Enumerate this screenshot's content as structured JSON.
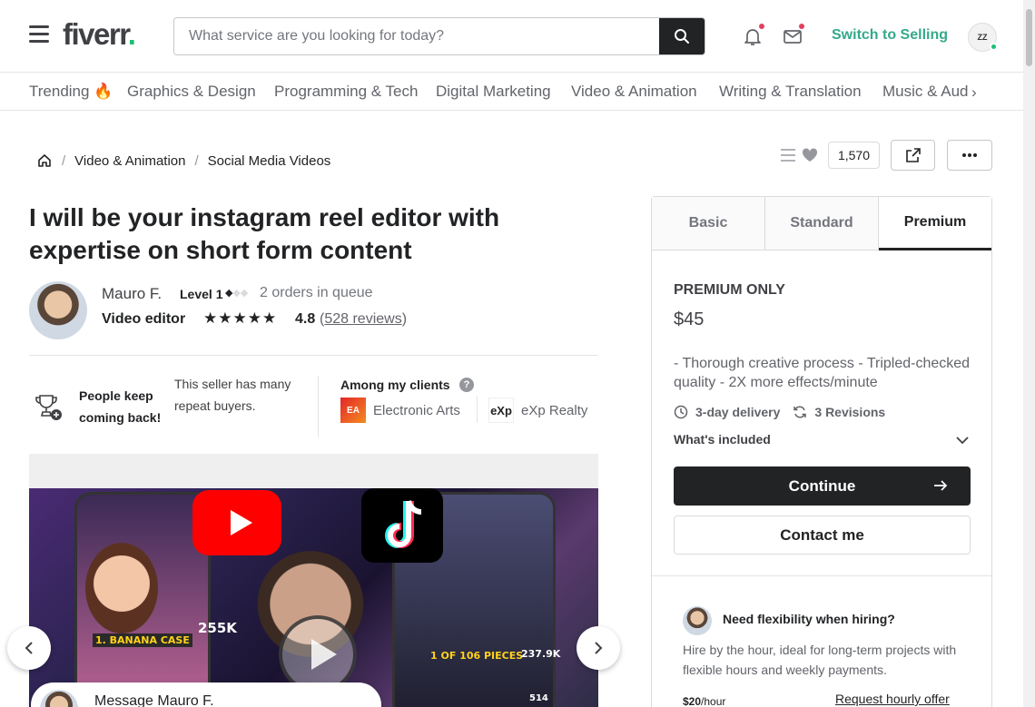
{
  "header": {
    "logo_text": "fiverr",
    "logo_dot": ".",
    "search_placeholder": "What service are you looking for today?",
    "switch_selling": "Switch to Selling",
    "avatar_text": "ZZ"
  },
  "categories": [
    {
      "label": "Trending 🔥"
    },
    {
      "label": "Graphics & Design"
    },
    {
      "label": "Programming & Tech"
    },
    {
      "label": "Digital Marketing"
    },
    {
      "label": "Video & Animation"
    },
    {
      "label": "Writing & Translation"
    },
    {
      "label": "Music & Aud"
    }
  ],
  "breadcrumb": {
    "items": [
      "Video & Animation",
      "Social Media Videos"
    ],
    "separator": "/"
  },
  "actions": {
    "likes_count": "1,570"
  },
  "gig": {
    "title": "I will be your instagram reel editor with expertise on short form content"
  },
  "seller": {
    "name": "Mauro F.",
    "level": "Level 1",
    "level_marks": "◆◆◆",
    "orders_queue": "2 orders in queue",
    "role": "Video editor",
    "stars": "★★★★★",
    "rating": "4.8",
    "reviews_open": "(",
    "reviews_link": "528 reviews",
    "reviews_close": ")"
  },
  "highlights": {
    "repeat_title": "People keep coming back!",
    "repeat_desc": "This seller has many repeat buyers.",
    "clients_title": "Among my clients",
    "clients_help": "?",
    "clients": [
      {
        "logo": "EA",
        "name": "Electronic Arts"
      },
      {
        "logo": "eXp",
        "name": "eXp Realty"
      }
    ]
  },
  "media": {
    "label_banana": "1. BANANA CASE",
    "count_likes": "255K",
    "label_pieces": "1 OF 106 PIECES",
    "count_right": "237.9K",
    "count_small": "514"
  },
  "message_bubble": {
    "text": "Message Mauro F."
  },
  "package": {
    "tabs": [
      {
        "label": "Basic"
      },
      {
        "label": "Standard"
      },
      {
        "label": "Premium"
      }
    ],
    "active_tab": "Premium",
    "name": "PREMIUM ONLY",
    "price": "$45",
    "description": "- Thorough creative process - Tripled-checked quality - 2X more effects/minute",
    "delivery": "3-day delivery",
    "revisions": "3 Revisions",
    "whats_included": "What's included",
    "continue_label": "Continue",
    "contact_label": "Contact me"
  },
  "flexibility": {
    "title": "Need flexibility when hiring?",
    "description": "Hire by the hour, ideal for long-term projects with flexible hours and weekly payments.",
    "rate": "$20",
    "rate_unit": "/hour",
    "request_offer": "Request hourly offer"
  },
  "colors": {
    "brand_green": "#1dbf73",
    "dark": "#222325",
    "notification_dot": "#e0405e"
  }
}
